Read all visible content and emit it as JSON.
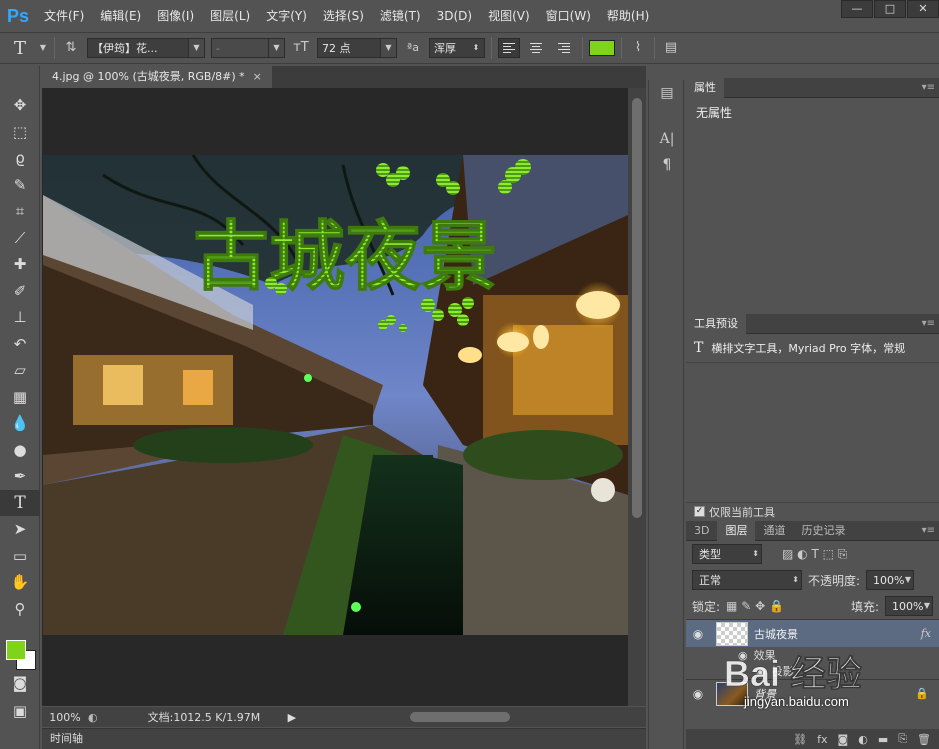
{
  "app": {
    "logo": "Ps",
    "menu": [
      "文件(F)",
      "编辑(E)",
      "图像(I)",
      "图层(L)",
      "文字(Y)",
      "选择(S)",
      "滤镜(T)",
      "3D(D)",
      "视图(V)",
      "窗口(W)",
      "帮助(H)"
    ],
    "window_controls": [
      "—",
      "□",
      "✕"
    ]
  },
  "options": {
    "font_family": "【伊筠】花...",
    "font_style": "-",
    "font_size": "72 点",
    "aa_label": "ªa",
    "antialias": "浑厚",
    "text_color": "#7fd41b",
    "tool_icon": "T"
  },
  "document": {
    "tab_title": "4.jpg @ 100% (古城夜景, RGB/8#) *",
    "tab_close": "×",
    "title_text": "古城夜景",
    "zoom": "100%",
    "doc_info": "文档:1012.5 K/1.97M",
    "timeline_label": "时间轴"
  },
  "colors": {
    "foreground": "#7fd41b",
    "background": "#ffffff"
  },
  "panels": {
    "properties": {
      "tab": "属性",
      "body": "无属性"
    },
    "presets": {
      "tab": "工具预设",
      "item_icon": "T",
      "item": "横排文字工具，Myriad Pro 字体，常规",
      "only_current": "仅限当前工具",
      "checked": "✓"
    },
    "layers": {
      "tabs": [
        "3D",
        "图层",
        "通道",
        "历史记录"
      ],
      "filter_kind": "类型",
      "blend_mode": "正常",
      "opacity_label": "不透明度:",
      "opacity": "100%",
      "lock_label": "锁定:",
      "fill_label": "填充:",
      "fill": "100%",
      "layer_items": [
        {
          "name": "古城夜景",
          "fx": "fx"
        },
        {
          "name": "效果"
        },
        {
          "name": "投影"
        },
        {
          "name": "背景"
        }
      ]
    }
  },
  "watermark": {
    "brand": "Bai 经验",
    "url": "jingyan.baidu.com"
  }
}
